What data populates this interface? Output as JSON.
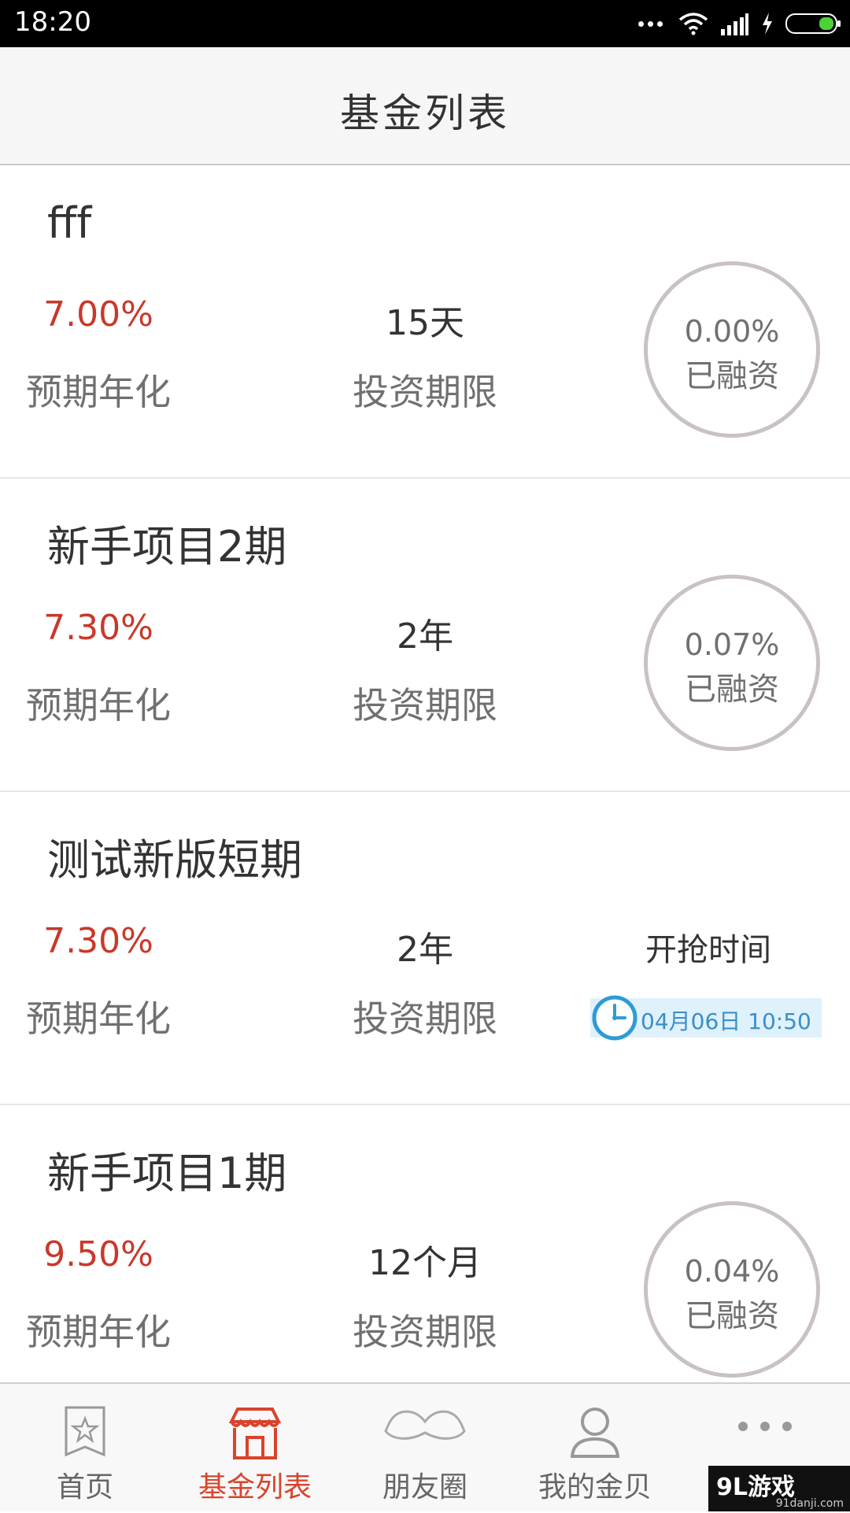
{
  "status_bar": {
    "time": "18:20"
  },
  "header": {
    "title": "基金列表"
  },
  "funds": [
    {
      "name": "fff",
      "rate": "7.00%",
      "rate_label": "预期年化",
      "term": "15天",
      "term_label": "投资期限",
      "raised": "0.00%",
      "raised_label": "已融资"
    },
    {
      "name": "新手项目2期",
      "rate": "7.30%",
      "rate_label": "预期年化",
      "term": "2年",
      "term_label": "投资期限",
      "raised": "0.07%",
      "raised_label": "已融资"
    },
    {
      "name": "测试新版短期",
      "rate": "7.30%",
      "rate_label": "预期年化",
      "term": "2年",
      "term_label": "投资期限",
      "start_label": "开抢时间",
      "start_time": "04月06日 10:50"
    },
    {
      "name": "新手项目1期",
      "rate": "9.50%",
      "rate_label": "预期年化",
      "term": "12个月",
      "term_label": "投资期限",
      "raised": "0.04%",
      "raised_label": "已融资"
    }
  ],
  "nav": [
    {
      "label": "首页",
      "icon": "star-bookmark-icon"
    },
    {
      "label": "基金列表",
      "icon": "store-icon",
      "active": true
    },
    {
      "label": "朋友圈",
      "icon": "mustache-icon"
    },
    {
      "label": "我的金贝",
      "icon": "user-icon"
    },
    {
      "label": "",
      "icon": "more-icon"
    }
  ],
  "watermark": {
    "main": "9L游戏",
    "sub": "91danji.com"
  },
  "colors": {
    "accent": "#d9432c",
    "rate": "#c8392b",
    "ring": "#c9c2c2",
    "time_bg": "#dff1fb",
    "time_text": "#3a8fc7"
  }
}
